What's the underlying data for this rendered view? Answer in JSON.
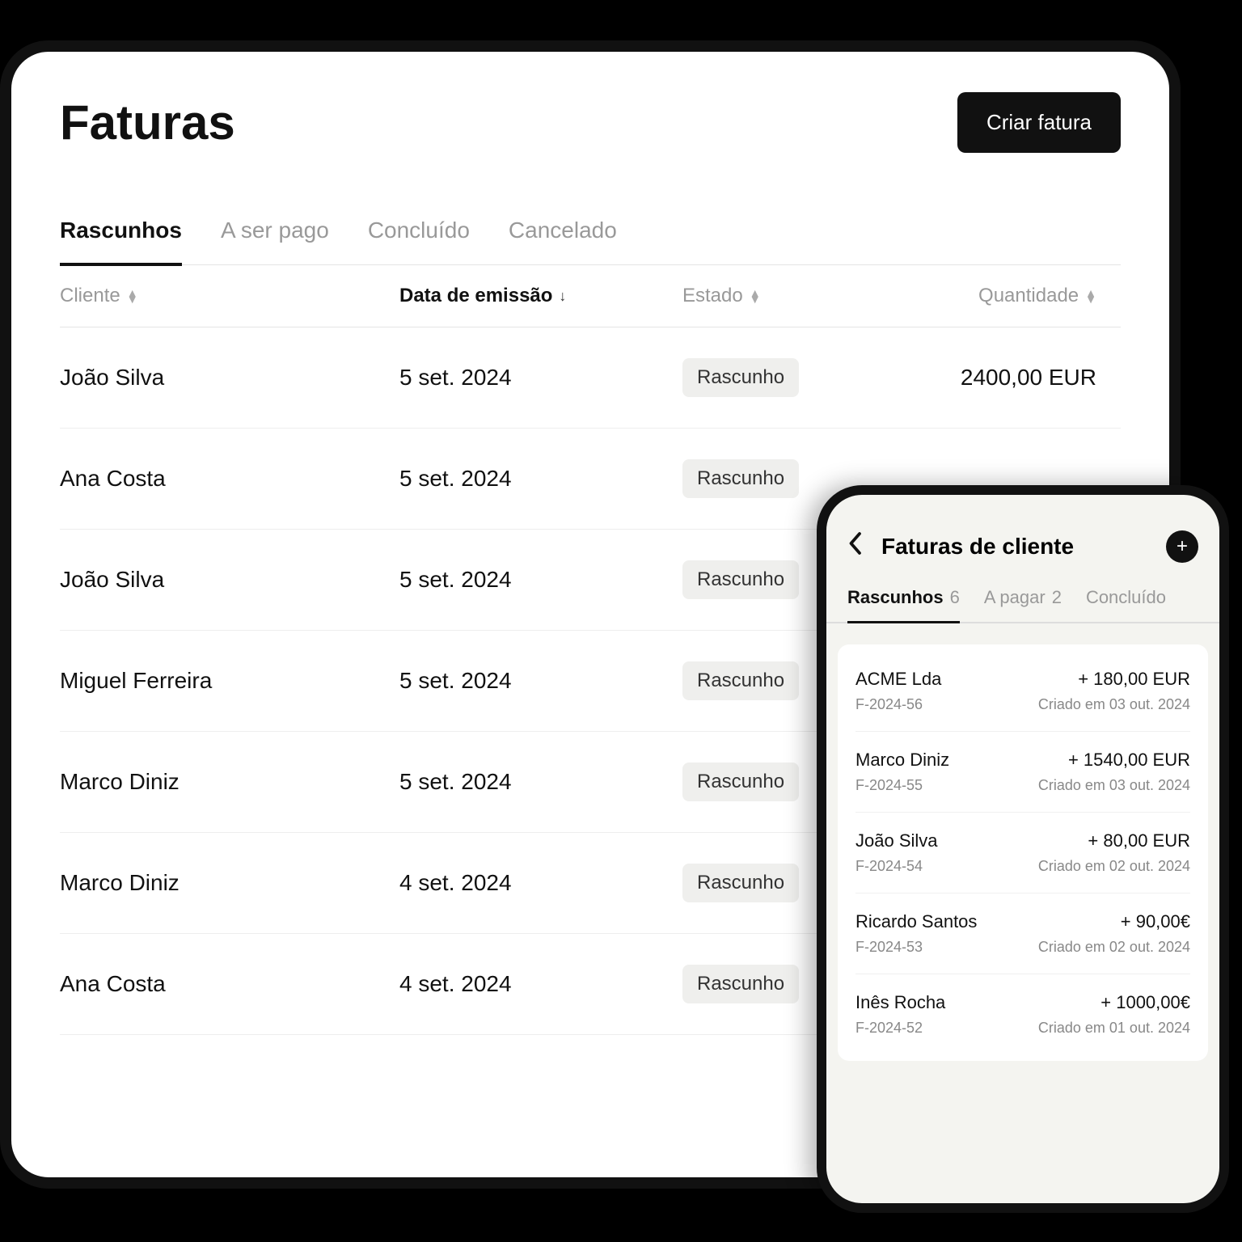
{
  "tablet": {
    "title": "Faturas",
    "create_label": "Criar fatura",
    "tabs": [
      "Rascunhos",
      "A ser pago",
      "Concluído",
      "Cancelado"
    ],
    "columns": {
      "cliente": "Cliente",
      "data": "Data de emissão",
      "estado": "Estado",
      "quantidade": "Quantidade"
    },
    "rows": [
      {
        "cliente": "João Silva",
        "data": "5 set. 2024",
        "estado": "Rascunho",
        "quantidade": "2400,00 EUR"
      },
      {
        "cliente": "Ana Costa",
        "data": "5 set. 2024",
        "estado": "Rascunho",
        "quantidade": ""
      },
      {
        "cliente": "João Silva",
        "data": "5 set. 2024",
        "estado": "Rascunho",
        "quantidade": ""
      },
      {
        "cliente": "Miguel Ferreira",
        "data": "5 set. 2024",
        "estado": "Rascunho",
        "quantidade": ""
      },
      {
        "cliente": "Marco Diniz",
        "data": "5 set. 2024",
        "estado": "Rascunho",
        "quantidade": ""
      },
      {
        "cliente": "Marco Diniz",
        "data": "4 set. 2024",
        "estado": "Rascunho",
        "quantidade": ""
      },
      {
        "cliente": "Ana Costa",
        "data": "4 set. 2024",
        "estado": "Rascunho",
        "quantidade": ""
      }
    ]
  },
  "phone": {
    "title": "Faturas de cliente",
    "tabs": [
      {
        "label": "Rascunhos",
        "count": "6"
      },
      {
        "label": "A pagar",
        "count": "2"
      },
      {
        "label": "Concluído",
        "count": ""
      }
    ],
    "items": [
      {
        "name": "ACME Lda",
        "amount": "+ 180,00 EUR",
        "ref": "F-2024-56",
        "created": "Criado em 03 out. 2024"
      },
      {
        "name": "Marco Diniz",
        "amount": "+ 1540,00 EUR",
        "ref": "F-2024-55",
        "created": "Criado em 03 out. 2024"
      },
      {
        "name": "João Silva",
        "amount": "+ 80,00 EUR",
        "ref": "F-2024-54",
        "created": "Criado em 02 out. 2024"
      },
      {
        "name": "Ricardo Santos",
        "amount": "+ 90,00€",
        "ref": "F-2024-53",
        "created": "Criado em 02 out. 2024"
      },
      {
        "name": "Inês Rocha",
        "amount": "+ 1000,00€",
        "ref": "F-2024-52",
        "created": "Criado em 01 out. 2024"
      }
    ]
  }
}
